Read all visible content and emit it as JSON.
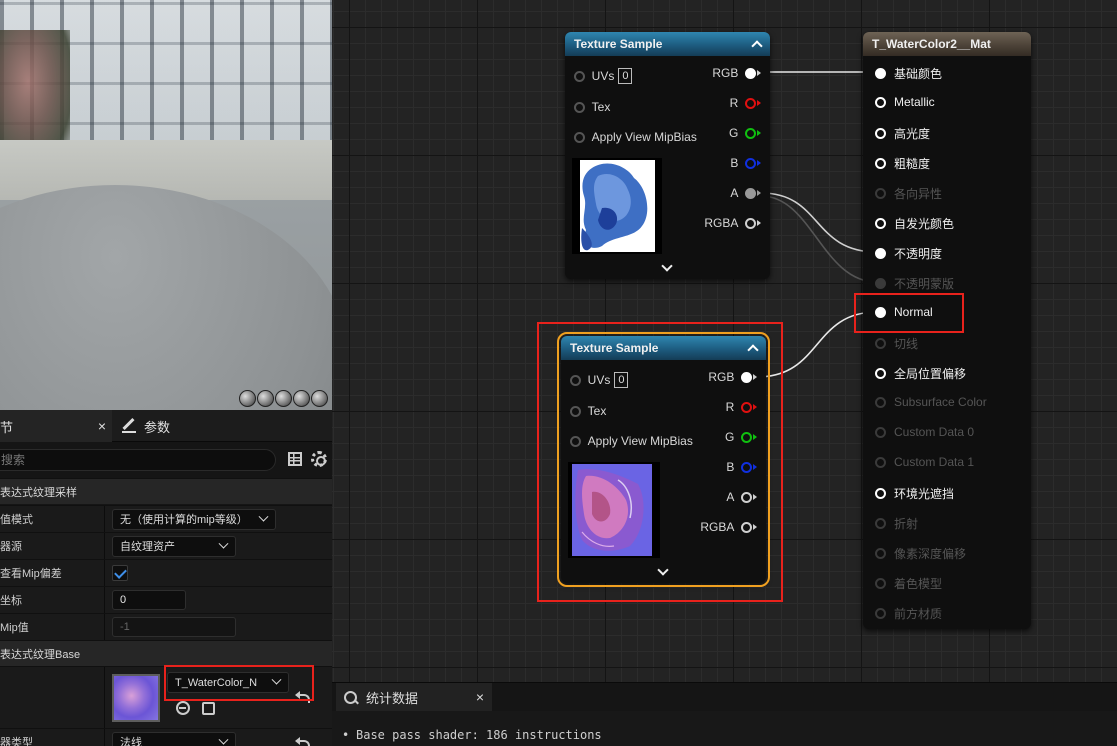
{
  "texture_sample_1": {
    "title": "Texture Sample",
    "inputs": [
      {
        "label": "UVs",
        "value": "0"
      },
      {
        "label": "Tex"
      },
      {
        "label": "Apply View MipBias"
      }
    ],
    "outputs": [
      "RGB",
      "R",
      "G",
      "B",
      "A",
      "RGBA"
    ]
  },
  "texture_sample_2": {
    "title": "Texture Sample",
    "inputs": [
      {
        "label": "UVs",
        "value": "0"
      },
      {
        "label": "Tex"
      },
      {
        "label": "Apply View MipBias"
      }
    ],
    "outputs": [
      "RGB",
      "R",
      "G",
      "B",
      "A",
      "RGBA"
    ]
  },
  "material_node": {
    "title": "T_WaterColor2__Mat",
    "inputs": [
      {
        "label": "基础颜色",
        "enabled": true,
        "connected": true
      },
      {
        "label": "Metallic",
        "enabled": true,
        "connected": false
      },
      {
        "label": "高光度",
        "enabled": true,
        "connected": false
      },
      {
        "label": "粗糙度",
        "enabled": true,
        "connected": false
      },
      {
        "label": "各向异性",
        "enabled": false,
        "connected": false
      },
      {
        "label": "自发光颜色",
        "enabled": true,
        "connected": false
      },
      {
        "label": "不透明度",
        "enabled": true,
        "connected": true
      },
      {
        "label": "不透明蒙版",
        "enabled": false,
        "connected": true
      },
      {
        "label": "Normal",
        "enabled": true,
        "connected": true
      },
      {
        "label": "切线",
        "enabled": false,
        "connected": false
      },
      {
        "label": "全局位置偏移",
        "enabled": true,
        "connected": false
      },
      {
        "label": "Subsurface Color",
        "enabled": false,
        "connected": false
      },
      {
        "label": "Custom Data 0",
        "enabled": false,
        "connected": false
      },
      {
        "label": "Custom Data 1",
        "enabled": false,
        "connected": false
      },
      {
        "label": "环境光遮挡",
        "enabled": true,
        "connected": false
      },
      {
        "label": "折射",
        "enabled": false,
        "connected": false
      },
      {
        "label": "像素深度偏移",
        "enabled": false,
        "connected": false
      },
      {
        "label": "着色模型",
        "enabled": false,
        "connected": false
      },
      {
        "label": "前方材质",
        "enabled": false,
        "connected": false
      }
    ]
  },
  "details_panel": {
    "tab_details": "节",
    "tab_params": "参数",
    "search_placeholder": "搜索",
    "section_sampler": "表达式纹理采样",
    "rows": {
      "mip_mode_label": "值模式",
      "mip_mode_value": "无（使用计算的mip等级）",
      "sampler_source_label": "器源",
      "sampler_source_value": "自纹理资产",
      "view_mip_label": "查看Mip偏差",
      "coord_label": "坐标",
      "coord_value": "0",
      "mip_value_label": "Mip值",
      "mip_value": "-1"
    },
    "section_base": "表达式纹理Base",
    "texture_asset": "T_WaterColor_N",
    "sampler_type_label": "器类型",
    "sampler_type_value": "法线"
  },
  "stats_panel": {
    "tab_label": "统计数据",
    "line": "Base pass shader: 186 instructions"
  },
  "colors": {
    "texture_header": "#1d5c80",
    "material_header": "#4a4036",
    "highlight_red": "#e8221c",
    "selection_orange": "#f0a020"
  }
}
